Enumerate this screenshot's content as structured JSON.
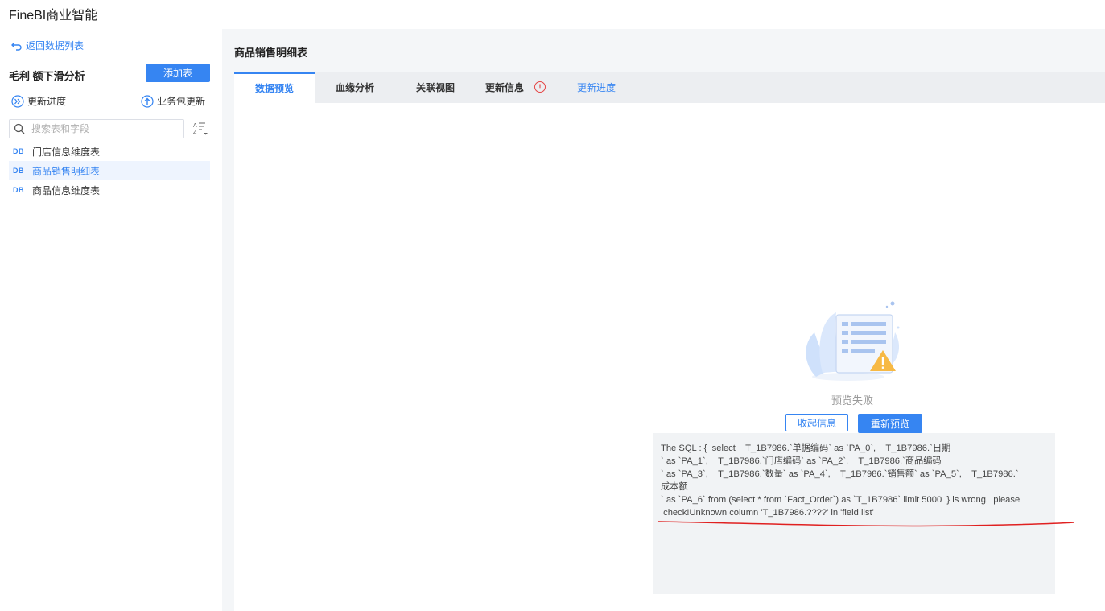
{
  "app_title": "FineBI商业智能",
  "sidebar": {
    "back_label": "返回数据列表",
    "package_name": "毛利 额下滑分析",
    "add_table_label": "添加表",
    "update_progress_label": "更新进度",
    "package_update_label": "业务包更新",
    "search_placeholder": "搜索表和字段",
    "db_badge": "DB",
    "tables": [
      {
        "label": "门店信息维度表",
        "active": false
      },
      {
        "label": "商品销售明细表",
        "active": true
      },
      {
        "label": "商品信息维度表",
        "active": false
      }
    ]
  },
  "main": {
    "title": "商品销售明细表",
    "tabs": [
      {
        "label": "数据预览",
        "active": true
      },
      {
        "label": "血缘分析"
      },
      {
        "label": "关联视图"
      },
      {
        "label": "更新信息"
      }
    ],
    "info_icon_glyph": "!",
    "update_progress_link": "更新进度",
    "preview_fail_text": "预览失败",
    "collapse_label": "收起信息",
    "retry_label": "重新预览",
    "error_text": "The SQL : {  select    T_1B7986.`单据编码` as `PA_0`,    T_1B7986.`日期\n` as `PA_1`,    T_1B7986.`门店编码` as `PA_2`,    T_1B7986.`商品编码\n` as `PA_3`,    T_1B7986.`数量` as `PA_4`,    T_1B7986.`销售额` as `PA_5`,    T_1B7986.`\n成本额\n` as `PA_6` from (select * from `Fact_Order`) as `T_1B7986` limit 5000  } is wrong,  please\n check!Unknown column 'T_1B7986.????' in 'field list'"
  },
  "colors": {
    "accent": "#3685f2",
    "error_red": "#e54545",
    "annotation_red": "#e02020"
  }
}
